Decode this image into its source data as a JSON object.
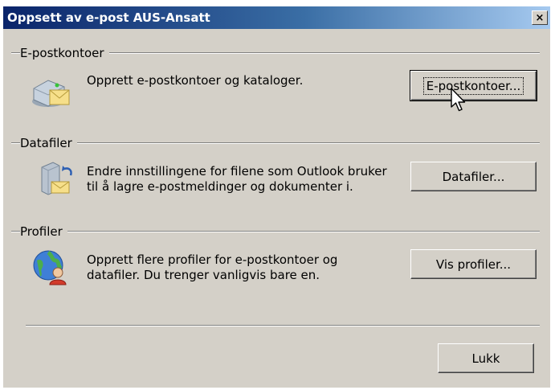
{
  "window": {
    "title": "Oppsett av e-post AUS-Ansatt",
    "close_glyph": "×"
  },
  "sections": {
    "accounts": {
      "heading": "E-postkontoer",
      "icon": "email-accounts-icon",
      "description_lines": [
        "Opprett e-postkontoer og kataloger."
      ],
      "button_label": "E-postkontoer..."
    },
    "datafiles": {
      "heading": "Datafiler",
      "icon": "data-files-icon",
      "description_lines": [
        "Endre innstillingene for filene som Outlook bruker",
        "til å lagre e-postmeldinger og dokumenter i."
      ],
      "button_label": "Datafiler..."
    },
    "profiles": {
      "heading": "Profiler",
      "icon": "profiles-icon",
      "description_lines": [
        "Opprett flere profiler for e-postkontoer og",
        "datafiler. Du trenger vanligvis bare en."
      ],
      "button_label": "Vis profiler..."
    }
  },
  "footer": {
    "close_label": "Lukk"
  },
  "colors": {
    "dialog_bg": "#d4d0c8",
    "titlebar_start": "#0a246a",
    "titlebar_end": "#a6caf0"
  }
}
